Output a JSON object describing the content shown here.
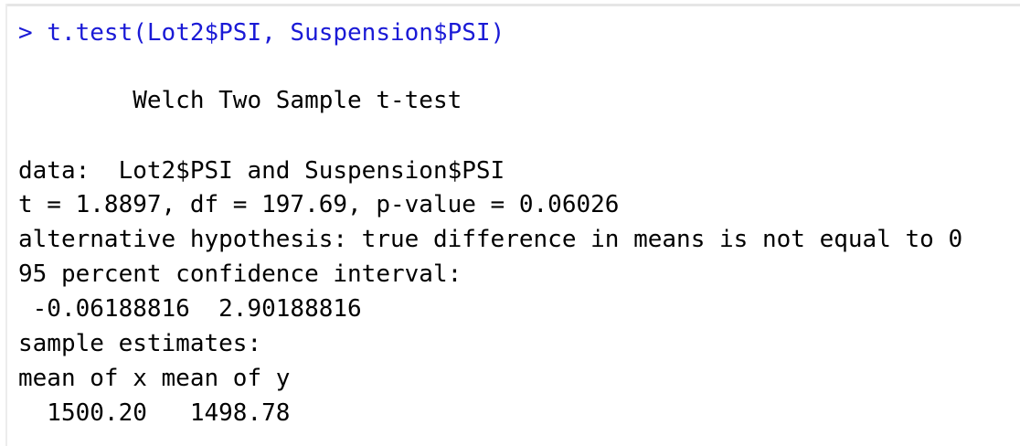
{
  "console": {
    "prompt": ">",
    "command": "t.test(Lot2$PSI, Suspension$PSI)",
    "output": {
      "title": "        Welch Two Sample t-test",
      "data_line": "data:  Lot2$PSI and Suspension$PSI",
      "stats_line": "t = 1.8897, df = 197.69, p-value = 0.06026",
      "alt_hypothesis": "alternative hypothesis: true difference in means is not equal to 0",
      "ci_label": "95 percent confidence interval:",
      "ci_values": " -0.06188816  2.90188816",
      "estimates_label": "sample estimates:",
      "estimates_header": "mean of x mean of y",
      "estimates_values": "  1500.20   1498.78"
    }
  },
  "colors": {
    "command": "#1a1ad6",
    "output": "#000000",
    "background": "#ffffff"
  }
}
